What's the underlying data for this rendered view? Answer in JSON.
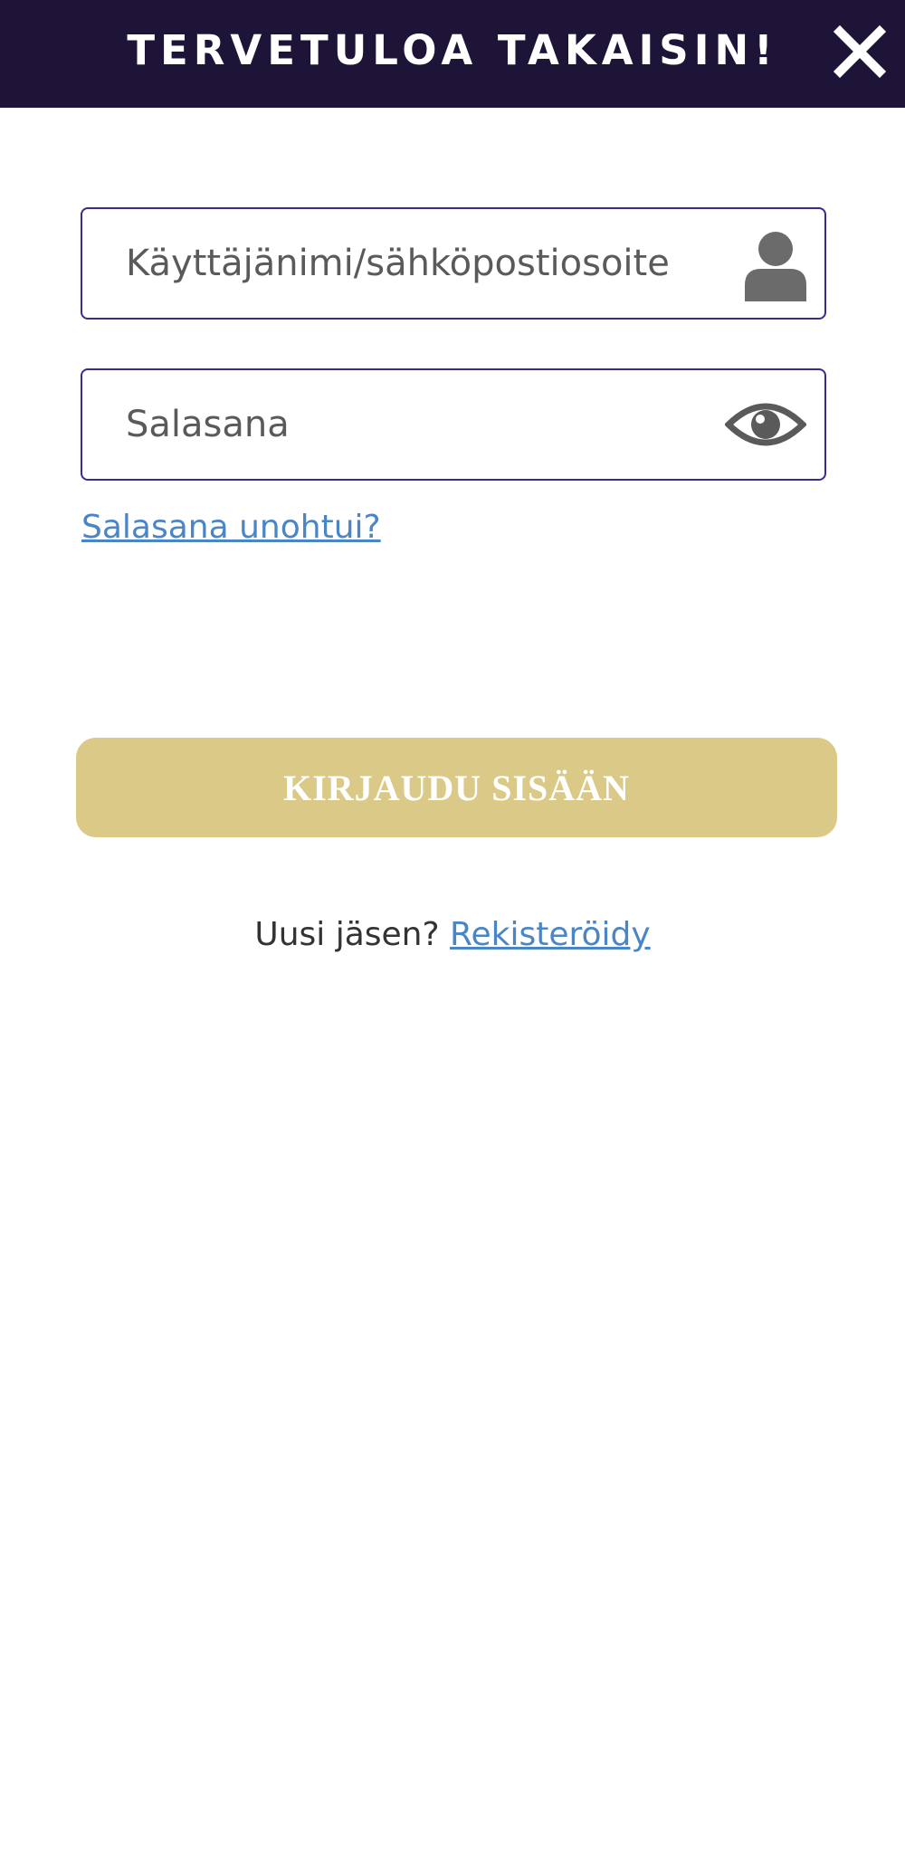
{
  "header": {
    "title": "TERVETULOA TAKAISIN!",
    "close_icon": "close-icon",
    "background_color": "#1e1438"
  },
  "login_form": {
    "username_placeholder": "Käyttäjänimi/sähköpostiosoite",
    "username_icon": "user-icon",
    "password_placeholder": "Salasana",
    "password_icon": "eye-icon",
    "forgot_password_label": "Salasana unohtui?",
    "submit_label": "KIRJAUDU SISÄÄN",
    "submit_color": "#dbc988",
    "border_color": "#3d2a8a",
    "link_color": "#4a86c5"
  },
  "register": {
    "prompt": "Uusi jäsen? ",
    "link_label": "Rekisteröidy"
  }
}
